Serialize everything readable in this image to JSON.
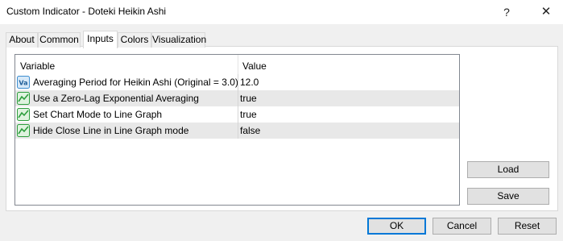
{
  "window": {
    "title": "Custom Indicator - Doteki Heikin Ashi",
    "help_glyph": "?",
    "close_glyph": "✕"
  },
  "tabs": [
    {
      "label": "About"
    },
    {
      "label": "Common"
    },
    {
      "label": "Inputs",
      "active": true
    },
    {
      "label": "Colors"
    },
    {
      "label": "Visualization"
    }
  ],
  "grid": {
    "header": {
      "variable": "Variable",
      "value": "Value"
    },
    "rows": [
      {
        "icon": "integer-input-icon",
        "variable": "Averaging Period for Heikin Ashi (Original = 3.0)",
        "value": "12.0"
      },
      {
        "icon": "boolean-input-icon",
        "variable": "Use a Zero-Lag Exponential Averaging",
        "value": "true"
      },
      {
        "icon": "boolean-input-icon",
        "variable": "Set Chart Mode to Line Graph",
        "value": "true"
      },
      {
        "icon": "boolean-input-icon",
        "variable": "Hide Close Line in Line Graph mode",
        "value": "false"
      }
    ]
  },
  "side_buttons": {
    "load": "Load",
    "save": "Save"
  },
  "footer_buttons": {
    "ok": "OK",
    "cancel": "Cancel",
    "reset": "Reset"
  },
  "colors": {
    "accent": "#0078d7",
    "row_alt": "#e8e8e8",
    "icon_blue": "#3e8ed0",
    "icon_green": "#2e9e3e"
  }
}
